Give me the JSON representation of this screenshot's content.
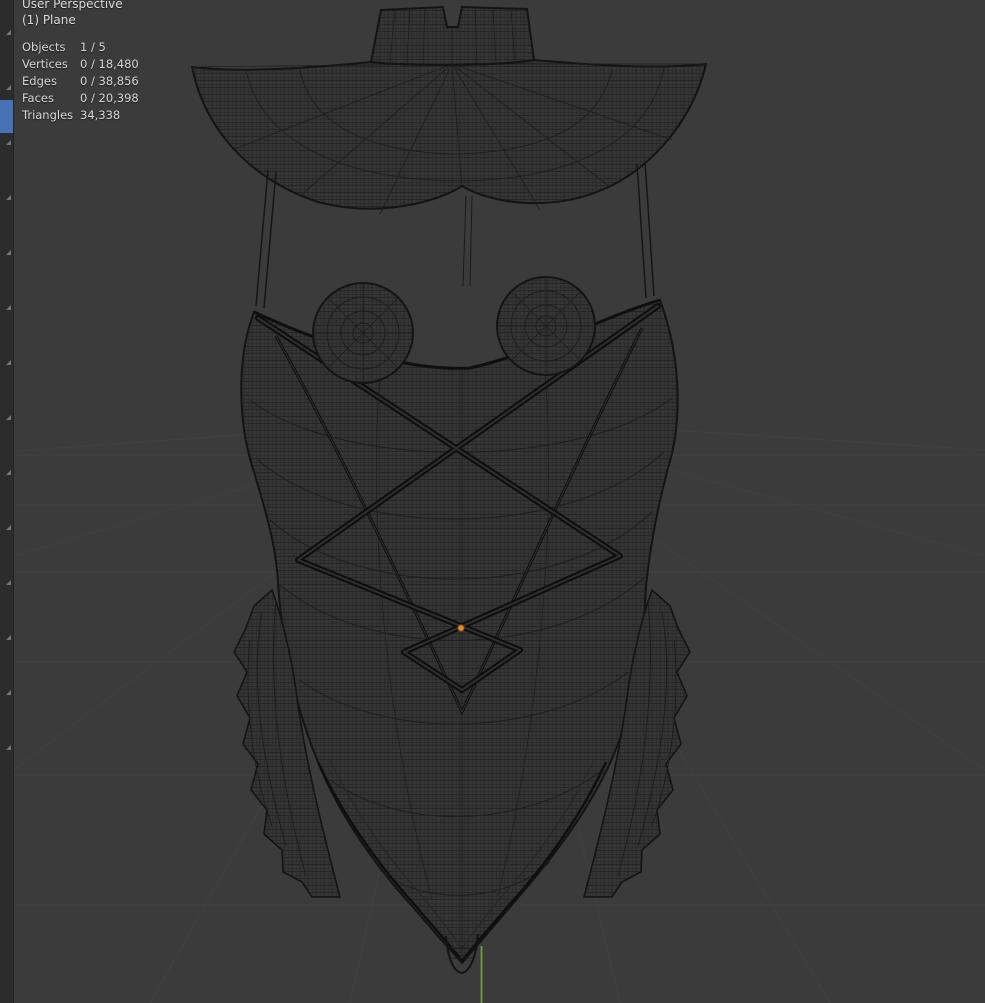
{
  "viewport": {
    "header": {
      "perspective": "User Perspective",
      "object": "(1) Plane"
    },
    "stats": {
      "rows": [
        {
          "label": "Objects",
          "value": "1 / 5"
        },
        {
          "label": "Vertices",
          "value": "0 / 18,480"
        },
        {
          "label": "Edges",
          "value": "0 / 38,856"
        },
        {
          "label": "Faces",
          "value": "0 / 20,398"
        },
        {
          "label": "Triangles",
          "value": "34,338"
        }
      ]
    },
    "scene": {
      "description": "Dense wireframe mesh of a high-neck bodysuit garment with a flared shoulder cape collar, twin circular cups, crossed front straps, ruffled hip frills, high-cut legs, an orange origin dot and a green axis line at bottom center"
    },
    "colors": {
      "background": "#3b3b3b",
      "toolbar": "#2c2c2c",
      "toolbar_highlight": "#4772b3",
      "grid_line": "#424242",
      "wireframe_line": "#1e1e1e",
      "mesh_outline": "#141414",
      "axis_green": "#6b9e3e",
      "origin_orange": "#e8872a",
      "overlay_text": "#dcdcdc"
    }
  },
  "toolbar": {
    "slot_count": 14
  }
}
